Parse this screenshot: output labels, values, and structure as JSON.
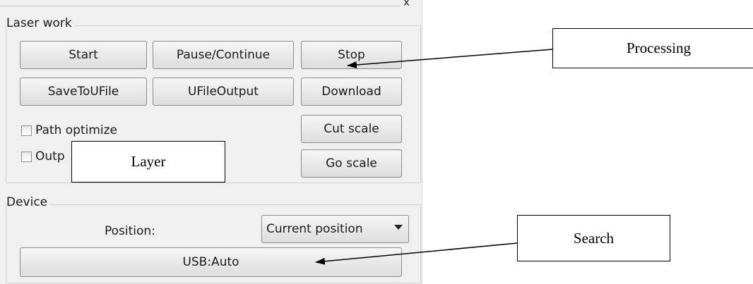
{
  "window": {
    "close_glyph": "x"
  },
  "laser_work": {
    "title": "Laser work",
    "buttons": {
      "start": "Start",
      "pause_continue": "Pause/Continue",
      "stop": "Stop",
      "save_to_ufile": "SaveToUFile",
      "ufile_output": "UFileOutput",
      "download": "Download",
      "cut_scale": "Cut scale",
      "go_scale": "Go scale"
    },
    "checkboxes": {
      "path_optimize": {
        "label": "Path optimize",
        "checked": false
      },
      "output": {
        "label": "Outp",
        "checked": false
      }
    }
  },
  "device": {
    "title": "Device",
    "position_label": "Position:",
    "position_select": "Current position",
    "usb_button": "USB:Auto"
  },
  "annotations": {
    "processing": "Processing",
    "layer": "Layer",
    "search": "Search"
  }
}
